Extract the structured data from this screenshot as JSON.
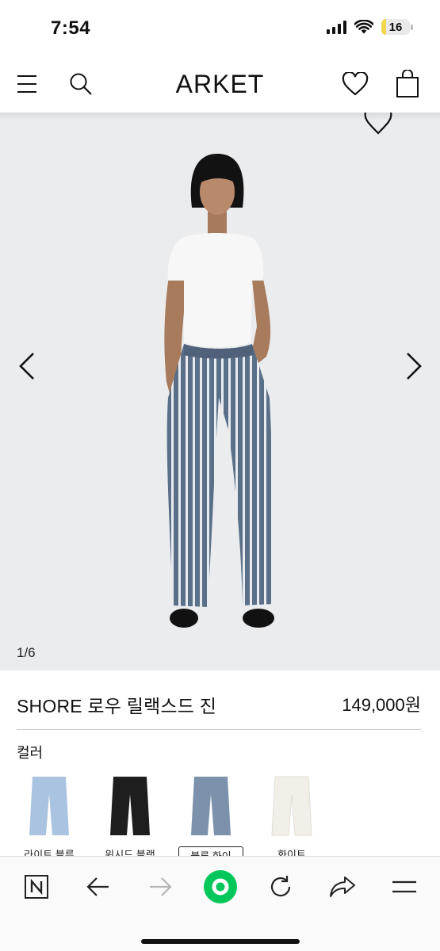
{
  "status_bar": {
    "time": "7:54",
    "battery": "16",
    "battery_level": 0.16,
    "battery_color": "#f2d64b"
  },
  "header": {
    "brand": "ARKET",
    "menu_icon": "hamburger-icon",
    "search_icon": "search-icon",
    "wishlist_icon": "heart-icon",
    "bag_icon": "shopping-bag-icon"
  },
  "gallery": {
    "counter": "1/6",
    "prev_icon": "chevron-left-icon",
    "next_icon": "chevron-right-icon"
  },
  "product": {
    "name": "SHORE 로우 릴랙스드 진",
    "price": "149,000원"
  },
  "colors": {
    "label": "컬러",
    "options": [
      {
        "name": "라이트 블루",
        "swatch": "#a9c3e0",
        "selected": false
      },
      {
        "name": "워시드 블랙",
        "swatch": "#1e1e1e",
        "selected": false
      },
      {
        "name": "블루 화이",
        "swatch": "#7c92ac",
        "selected": true
      },
      {
        "name": "화이트",
        "swatch": "#f1efe7",
        "selected": false
      }
    ]
  },
  "toolbar": {
    "items": [
      "naver-icon",
      "back-arrow-icon",
      "forward-arrow-icon",
      "green-circle-icon",
      "reload-icon",
      "share-icon",
      "menu-icon"
    ],
    "accent": "#03c75a"
  }
}
